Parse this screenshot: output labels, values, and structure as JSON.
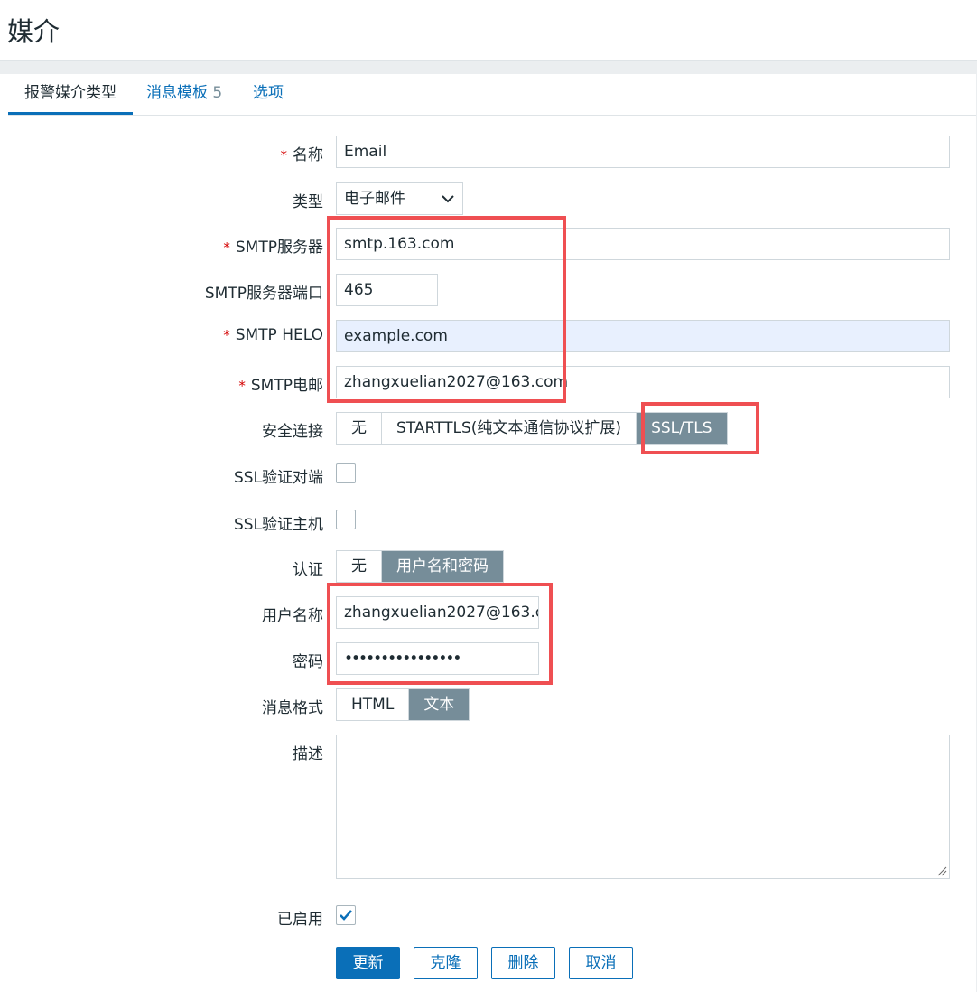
{
  "page": {
    "title": "媒介"
  },
  "tabs": [
    {
      "label": "报警媒介类型",
      "count": ""
    },
    {
      "label": "消息模板",
      "count": "5"
    },
    {
      "label": "选项",
      "count": ""
    }
  ],
  "form": {
    "name": {
      "label": "名称",
      "required": "*",
      "value": "Email"
    },
    "type": {
      "label": "类型",
      "value": "电子邮件"
    },
    "smtp_server": {
      "label": "SMTP服务器",
      "required": "*",
      "value": "smtp.163.com"
    },
    "smtp_port": {
      "label": "SMTP服务器端口",
      "value": "465"
    },
    "smtp_helo": {
      "label": "SMTP HELO",
      "required": "*",
      "value": "example.com"
    },
    "smtp_email": {
      "label": "SMTP电邮",
      "required": "*",
      "value": "zhangxuelian2027@163.com"
    },
    "security": {
      "label": "安全连接",
      "options": [
        "无",
        "STARTTLS(纯文本通信协议扩展)",
        "SSL/TLS"
      ],
      "selected": "SSL/TLS"
    },
    "ssl_verify_peer": {
      "label": "SSL验证对端",
      "checked": false
    },
    "ssl_verify_host": {
      "label": "SSL验证主机",
      "checked": false
    },
    "auth": {
      "label": "认证",
      "options": [
        "无",
        "用户名和密码"
      ],
      "selected": "用户名和密码"
    },
    "username": {
      "label": "用户名称",
      "value": "zhangxuelian2027@163.c"
    },
    "password": {
      "label": "密码",
      "value": "••••••••••••••••"
    },
    "message_format": {
      "label": "消息格式",
      "options": [
        "HTML",
        "文本"
      ],
      "selected": "文本"
    },
    "description": {
      "label": "描述",
      "value": ""
    },
    "enabled": {
      "label": "已启用",
      "checked": true
    }
  },
  "buttons": {
    "update": "更新",
    "clone": "克隆",
    "delete": "删除",
    "cancel": "取消"
  },
  "colors": {
    "accent": "#0a6fb8",
    "segment_selected": "#768d99",
    "highlight": "#ef4f52",
    "required": "#d40000"
  }
}
